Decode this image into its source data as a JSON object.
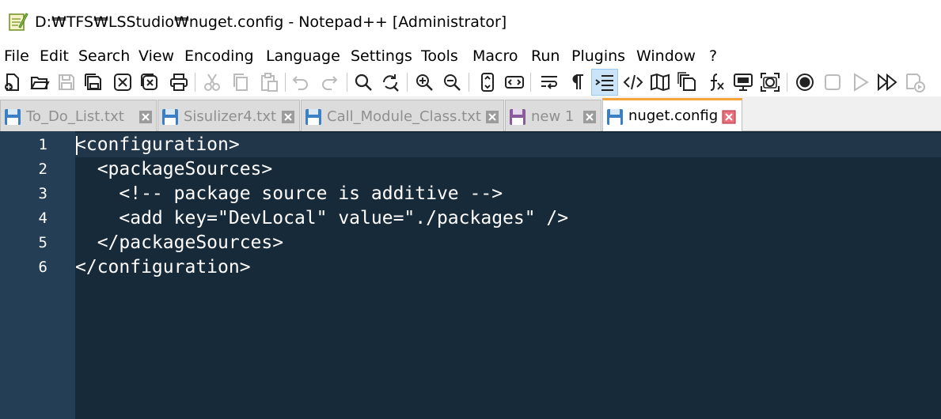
{
  "window": {
    "title": "D:₩TFS₩LSStudio₩nuget.config - Notepad++ [Administrator]",
    "app_icon": "notepadpp-icon"
  },
  "menu": [
    "File",
    "Edit",
    "Search",
    "View",
    "Encoding",
    "Language",
    "Settings",
    "Tools",
    "Macro",
    "Run",
    "Plugins",
    "Window",
    "?"
  ],
  "toolbar": {
    "icons": [
      "new-file-icon",
      "open-folder-icon",
      "save-icon",
      "save-all-icon",
      "close-icon",
      "close-all-icon",
      "print-icon",
      "cut-icon",
      "copy-icon",
      "paste-icon",
      "undo-icon",
      "redo-icon",
      "find-icon",
      "replace-icon",
      "zoom-in-icon",
      "zoom-out-icon",
      "sync-vertical-icon",
      "sync-horizontal-icon",
      "word-wrap-icon",
      "show-all-chars-icon",
      "indent-guide-icon",
      "xml-tag-icon",
      "document-map-icon",
      "clone-doc-icon",
      "function-list-icon",
      "monitor-icon",
      "screenshot-icon",
      "macro-record-icon",
      "macro-stop-icon",
      "macro-play-icon",
      "macro-run-multiple-icon",
      "macro-save-icon"
    ],
    "active_icon": "indent-guide-icon"
  },
  "tabs": [
    {
      "label": "To_Do_List.txt",
      "active": false
    },
    {
      "label": "Sisulizer4.txt",
      "active": false
    },
    {
      "label": "Call_Module_Class.txt",
      "active": false
    },
    {
      "label": "new 1",
      "active": false
    },
    {
      "label": "nuget.config",
      "active": true
    }
  ],
  "editor": {
    "colors": {
      "background": "#172a3a",
      "gutter": "#233e55",
      "text": "#ffffff"
    },
    "lines": [
      {
        "num": "1",
        "text": "<configuration>"
      },
      {
        "num": "2",
        "text": "  <packageSources>"
      },
      {
        "num": "3",
        "text": "    <!-- package source is additive -->"
      },
      {
        "num": "4",
        "text": "    <add key=\"DevLocal\" value=\"./packages\" />"
      },
      {
        "num": "5",
        "text": "  </packageSources>"
      },
      {
        "num": "6",
        "text": "</configuration>"
      }
    ]
  }
}
